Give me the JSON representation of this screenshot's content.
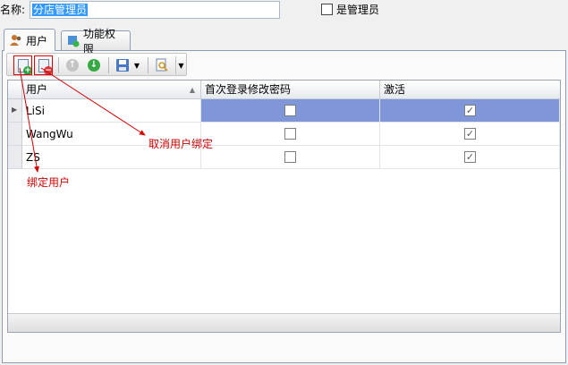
{
  "form": {
    "name_label": "名称:",
    "name_value": "分店管理员",
    "is_admin_label": "是管理员",
    "is_admin_checked": false
  },
  "tabs": [
    {
      "label": "用户",
      "active": true,
      "icon": "users-icon"
    },
    {
      "label": "功能权限",
      "active": false,
      "icon": "permissions-icon"
    }
  ],
  "toolbar": {
    "buttons": [
      {
        "name": "bind-user",
        "icon": "document-add-icon"
      },
      {
        "name": "unbind-user",
        "icon": "document-remove-icon"
      },
      {
        "name": "move-up",
        "icon": "arrow-up-circle-icon",
        "enabled": false
      },
      {
        "name": "move-down",
        "icon": "arrow-down-circle-icon",
        "enabled": true
      },
      {
        "name": "save",
        "icon": "save-icon"
      },
      {
        "name": "query",
        "icon": "search-icon"
      }
    ]
  },
  "grid": {
    "columns": [
      "用户",
      "首次登录修改密码",
      "激活"
    ],
    "rows": [
      {
        "user": "LiSi",
        "first_login_change_password": false,
        "active": true,
        "selected": true
      },
      {
        "user": "WangWu",
        "first_login_change_password": false,
        "active": true,
        "selected": false
      },
      {
        "user": "ZS",
        "first_login_change_password": false,
        "active": true,
        "selected": false
      }
    ]
  },
  "annotations": {
    "unbind": "取消用户绑定",
    "bind": "绑定用户"
  },
  "colors": {
    "selection": "#7f96d8",
    "annotation": "#d40000"
  }
}
